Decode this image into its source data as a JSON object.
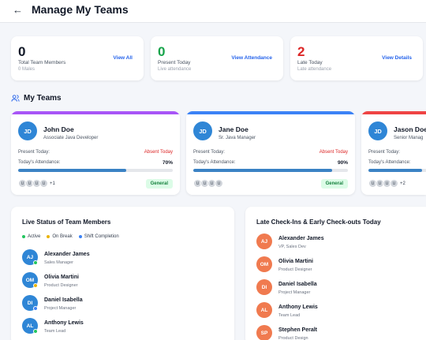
{
  "header": {
    "back_icon": "arrow-left-icon",
    "title": "Manage My Teams"
  },
  "stats": [
    {
      "value": "0",
      "label": "Total Team Members",
      "sub": "0 Males",
      "link": "View All",
      "color": "#111827"
    },
    {
      "value": "0",
      "label": "Present Today",
      "sub": "Live attendance",
      "link": "View Attendance",
      "color": "#16a34a"
    },
    {
      "value": "2",
      "label": "Late Today",
      "sub": "Late attendance",
      "link": "View Details",
      "color": "#dc2626"
    }
  ],
  "my_teams": {
    "title": "My Teams",
    "icon": "users-icon",
    "teams": [
      {
        "initials": "JD",
        "name": "John Doe",
        "role": "Associate Java Developer",
        "present_label": "Present Today:",
        "present_value": "Absent Today",
        "attendance_label": "Today's Attendance:",
        "attendance_value": "70%",
        "attendance": 0.7,
        "members": [
          "U",
          "U",
          "U",
          "U"
        ],
        "more": "+1",
        "tag": "General",
        "bar_color": "#a855f7"
      },
      {
        "initials": "JD",
        "name": "Jane Doe",
        "role": "Sr. Java Manager",
        "present_label": "Present Today:",
        "present_value": "Absent Today",
        "attendance_label": "Today's Attendance:",
        "attendance_value": "90%",
        "attendance": 0.9,
        "members": [
          "U",
          "U",
          "U",
          "U"
        ],
        "more": "",
        "tag": "General",
        "bar_color": "#3b82f6"
      },
      {
        "initials": "JD",
        "name": "Jason Doe",
        "role": "Senior Manag",
        "present_label": "Present Today:",
        "present_value": "",
        "attendance_label": "Today's Attendance:",
        "attendance_value": "",
        "attendance": 0.85,
        "members": [
          "U",
          "U",
          "U",
          "U"
        ],
        "more": "+2",
        "tag": "",
        "bar_color": "#ef4444"
      }
    ]
  },
  "live_status": {
    "title": "Live Status of Team Members",
    "legend": [
      {
        "label": "Active",
        "color": "#22c55e"
      },
      {
        "label": "On Break",
        "color": "#eab308"
      },
      {
        "label": "Shift Completion",
        "color": "#3b82f6"
      }
    ],
    "members": [
      {
        "initials": "AJ",
        "name": "Alexander James",
        "role": "Sales Manager",
        "status_color": "#22c55e"
      },
      {
        "initials": "OM",
        "name": "Olivia Martini",
        "role": "Product Designer",
        "status_color": "#eab308"
      },
      {
        "initials": "DI",
        "name": "Daniel Isabella",
        "role": "Project Manager",
        "status_color": "#3b82f6"
      },
      {
        "initials": "AL",
        "name": "Anthony Lewis",
        "role": "Team Lead",
        "status_color": "#22c55e"
      }
    ]
  },
  "late_checkins": {
    "title": "Late Check-Ins & Early Check-outs Today",
    "members": [
      {
        "initials": "AJ",
        "name": "Alexander James",
        "role": "VP, Sales Dev"
      },
      {
        "initials": "OM",
        "name": "Olivia Martini",
        "role": "Product Designer"
      },
      {
        "initials": "DI",
        "name": "Daniel Isabella",
        "role": "Project Manager"
      },
      {
        "initials": "AL",
        "name": "Anthony Lewis",
        "role": "Team Lead"
      },
      {
        "initials": "SP",
        "name": "Stephen Peralt",
        "role": "Product Design"
      }
    ]
  },
  "colors": {
    "avatar_blue": "#2f86d6",
    "avatar_orange": "#f07a4f",
    "link": "#2563eb"
  }
}
